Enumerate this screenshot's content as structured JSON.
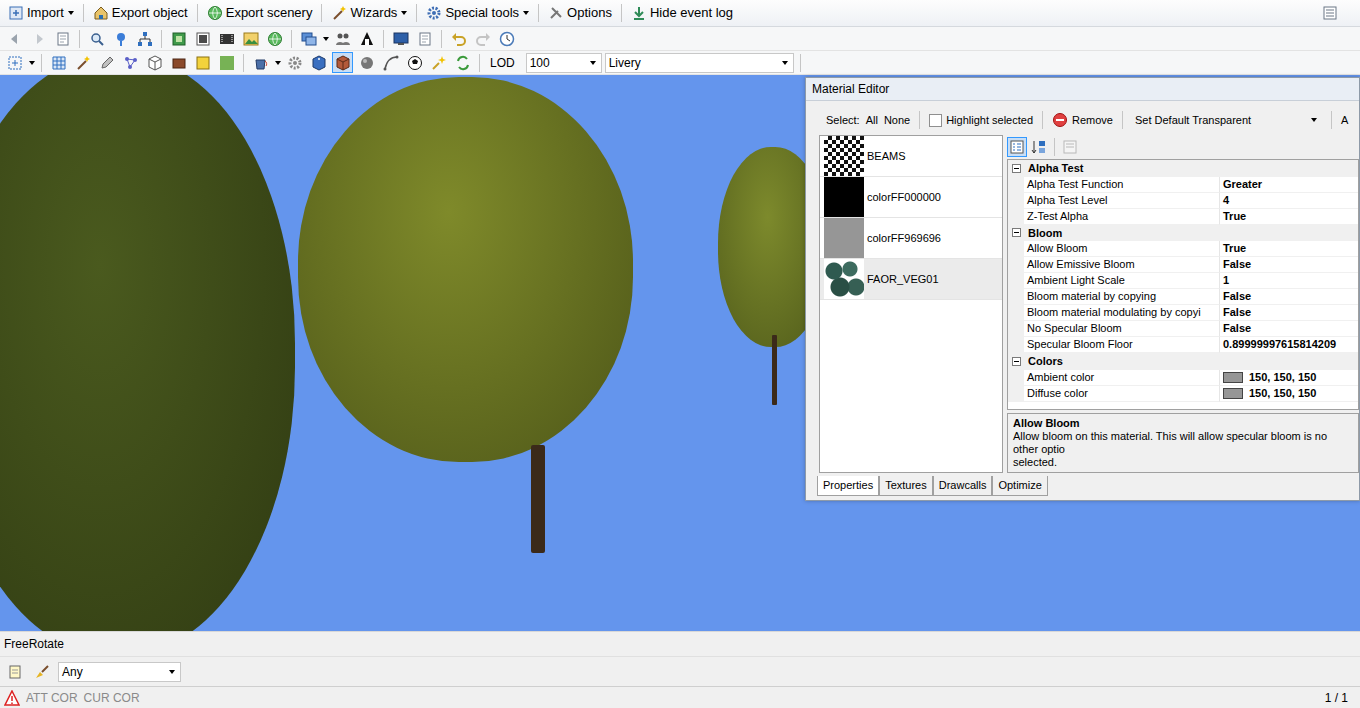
{
  "menu": [
    {
      "label": "Import",
      "dropdown": true
    },
    {
      "label": "Export object",
      "dropdown": false
    },
    {
      "label": "Export scenery",
      "dropdown": false
    },
    {
      "label": "Wizards",
      "dropdown": true
    },
    {
      "label": "Special tools",
      "dropdown": true
    },
    {
      "label": "Options",
      "dropdown": false
    },
    {
      "label": "Hide event log",
      "dropdown": false
    }
  ],
  "view_tools": [
    {
      "selected": false
    },
    {
      "selected": false
    },
    {
      "selected": true
    },
    {
      "selected": false
    },
    {
      "selected": false
    },
    {
      "selected": false
    },
    {
      "selected": false
    },
    {
      "selected": false
    }
  ],
  "lod": {
    "label": "LOD",
    "value": "100"
  },
  "livery": {
    "value": "Livery"
  },
  "viewport": {
    "mode": "FreeRotate"
  },
  "filter": {
    "value": "Any"
  },
  "status_bar": {
    "indicators": [
      {
        "label": "ATT COR",
        "disabled": true
      },
      {
        "label": "CUR COR",
        "disabled": true
      }
    ],
    "page": "1 / 1"
  },
  "material_editor": {
    "title": "Material Editor",
    "select_label": "Select:",
    "select_links": [
      "All",
      "None"
    ],
    "highlight": {
      "label": "Highlight selected",
      "checked": false
    },
    "remove": "Remove",
    "preset": "Set Default Transparent",
    "cut_label": "A",
    "materials": [
      {
        "name": "BEAMS",
        "kind": "checker",
        "selected": false
      },
      {
        "name": "colorFF000000",
        "kind": "solid",
        "color": "#000000",
        "selected": false
      },
      {
        "name": "colorFF969696",
        "kind": "solid",
        "color": "#969696",
        "selected": false
      },
      {
        "name": "FAOR_VEG01",
        "kind": "texture",
        "selected": true
      }
    ],
    "grid_buttons": [
      {
        "selected": true,
        "disabled": false
      },
      {
        "selected": false,
        "disabled": false
      },
      {
        "selected": false,
        "disabled": true
      }
    ],
    "categories": [
      {
        "name": "Alpha Test",
        "expanded": true,
        "properties": [
          {
            "name": "Alpha Test Function",
            "value": "Greater",
            "kind": "text"
          },
          {
            "name": "Alpha Test Level",
            "value": "4",
            "kind": "text"
          },
          {
            "name": "Z-Test Alpha",
            "value": "True",
            "kind": "text"
          }
        ]
      },
      {
        "name": "Bloom",
        "expanded": true,
        "properties": [
          {
            "name": "Allow Bloom",
            "value": "True",
            "kind": "text"
          },
          {
            "name": "Allow Emissive Bloom",
            "value": "False",
            "kind": "text"
          },
          {
            "name": "Ambient Light Scale",
            "value": "1",
            "kind": "text"
          },
          {
            "name": "Bloom material by copying",
            "value": "False",
            "kind": "text"
          },
          {
            "name": "Bloom material modulating by copyi",
            "value": "False",
            "kind": "text"
          },
          {
            "name": "No Specular Bloom",
            "value": "False",
            "kind": "text"
          },
          {
            "name": "Specular Bloom Floor",
            "value": "0.89999997615814209",
            "kind": "text"
          }
        ]
      },
      {
        "name": "Colors",
        "expanded": true,
        "properties": [
          {
            "name": "Ambient color",
            "value": "150, 150, 150",
            "kind": "color",
            "color": "#969696"
          },
          {
            "name": "Diffuse color",
            "value": "150, 150, 150",
            "kind": "color",
            "color": "#969696"
          }
        ]
      }
    ],
    "description": {
      "title": "Allow Bloom",
      "lines": [
        "Allow bloom on this material. This will allow specular bloom is no other optio",
        "selected."
      ]
    },
    "tabs": [
      {
        "label": "Properties",
        "selected": true
      },
      {
        "label": "Textures",
        "selected": false
      },
      {
        "label": "Drawcalls",
        "selected": false
      },
      {
        "label": "Optimize",
        "selected": false
      }
    ]
  }
}
